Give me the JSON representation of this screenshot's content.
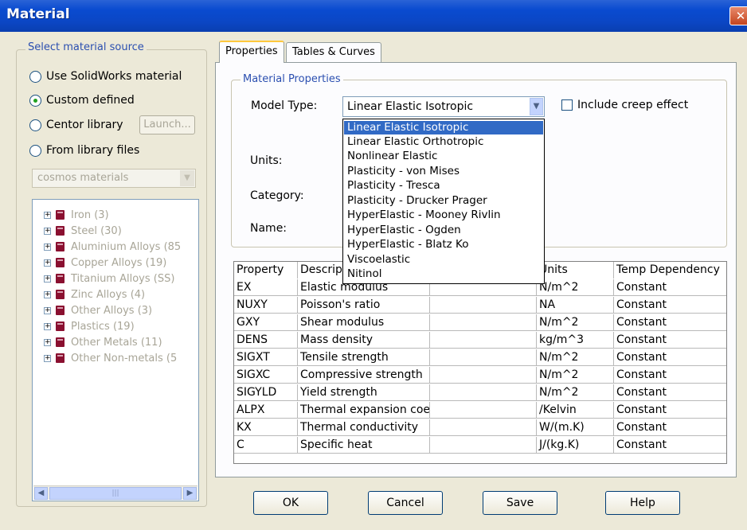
{
  "window": {
    "title": "Material",
    "close_glyph": "✕"
  },
  "source_group": {
    "legend": "Select material source",
    "options": [
      {
        "label": "Use SolidWorks material",
        "checked": false
      },
      {
        "label": "Custom defined",
        "checked": true
      },
      {
        "label": "Centor library",
        "checked": false
      },
      {
        "label": "From library files",
        "checked": false
      }
    ],
    "launch_label": "Launch...",
    "library_select": "cosmos materials",
    "tree": [
      "Iron (3)",
      "Steel (30)",
      "Aluminium Alloys (85",
      "Copper Alloys (19)",
      "Titanium Alloys (SS)",
      "Zinc Alloys (4)",
      "Other Alloys (3)",
      "Plastics (19)",
      "Other Metals (11)",
      "Other Non-metals (5"
    ]
  },
  "tabs": [
    {
      "label": "Properties",
      "active": true
    },
    {
      "label": "Tables & Curves",
      "active": false
    }
  ],
  "material_props": {
    "legend": "Material Properties",
    "model_type_label": "Model Type:",
    "model_type_value": "Linear Elastic Isotropic",
    "units_label": "Units:",
    "category_label": "Category:",
    "name_label": "Name:",
    "creep_label": "Include creep effect"
  },
  "dropdown_options": [
    "Linear Elastic Isotropic",
    "Linear Elastic Orthotropic",
    "Nonlinear Elastic",
    "Plasticity - von Mises",
    "Plasticity - Tresca",
    "Plasticity - Drucker Prager",
    "HyperElastic - Mooney Rivlin",
    "HyperElastic - Ogden",
    "HyperElastic - Blatz Ko",
    "Viscoelastic",
    "Nitinol"
  ],
  "table": {
    "headers": [
      "Property",
      "Descrip",
      "",
      "Units",
      "Temp Dependency"
    ],
    "rows": [
      [
        "EX",
        "Elastic modulus",
        "",
        "N/m^2",
        "Constant"
      ],
      [
        "NUXY",
        "Poisson's ratio",
        "",
        "NA",
        "Constant"
      ],
      [
        "GXY",
        "Shear modulus",
        "",
        "N/m^2",
        "Constant"
      ],
      [
        "DENS",
        "Mass density",
        "",
        "kg/m^3",
        "Constant"
      ],
      [
        "SIGXT",
        "Tensile strength",
        "",
        "N/m^2",
        "Constant"
      ],
      [
        "SIGXC",
        "Compressive strength",
        "",
        "N/m^2",
        "Constant"
      ],
      [
        "SIGYLD",
        "Yield strength",
        "",
        "N/m^2",
        "Constant"
      ],
      [
        "ALPX",
        "Thermal expansion coe",
        "",
        "/Kelvin",
        "Constant"
      ],
      [
        "KX",
        "Thermal conductivity",
        "",
        "W/(m.K)",
        "Constant"
      ],
      [
        "C",
        "Specific heat",
        "",
        "J/(kg.K)",
        "Constant"
      ]
    ]
  },
  "buttons": {
    "ok": "OK",
    "cancel": "Cancel",
    "save": "Save",
    "help": "Help"
  }
}
